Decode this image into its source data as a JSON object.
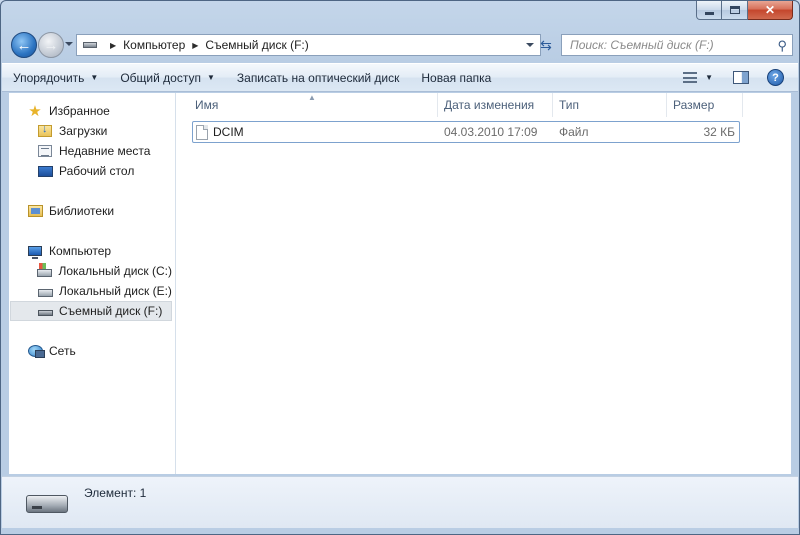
{
  "window": {
    "caption_buttons": {
      "minimize": "minimize-icon",
      "maximize": "maximize-icon",
      "close": "✕"
    }
  },
  "address_bar": {
    "crumbs": [
      "Компьютер",
      "Съемный диск (F:)"
    ],
    "separator": "▶"
  },
  "search": {
    "placeholder": "Поиск: Съемный диск (F:)"
  },
  "toolbar": {
    "organize": "Упорядочить",
    "share": "Общий доступ",
    "burn": "Записать на оптический диск",
    "new_folder": "Новая папка",
    "help": "?"
  },
  "nav_pane": {
    "favorites": {
      "title": "Избранное",
      "items": [
        "Загрузки",
        "Недавние места",
        "Рабочий стол"
      ]
    },
    "libraries": {
      "title": "Библиотеки"
    },
    "computer": {
      "title": "Компьютер",
      "items": [
        "Локальный диск (C:)",
        "Локальный диск (E:)",
        "Съемный диск (F:)"
      ]
    },
    "network": {
      "title": "Сеть"
    }
  },
  "file_list": {
    "columns": [
      "Имя",
      "Дата изменения",
      "Тип",
      "Размер"
    ],
    "rows": [
      {
        "name": "DCIM",
        "date": "04.03.2010 17:09",
        "type": "Файл",
        "size": "32 КБ"
      }
    ]
  },
  "details_pane": {
    "status": "Элемент: 1"
  },
  "colors": {
    "selection_border": "#7da2ce",
    "accent": "#2c74c2",
    "close_button": "#c4462c"
  }
}
